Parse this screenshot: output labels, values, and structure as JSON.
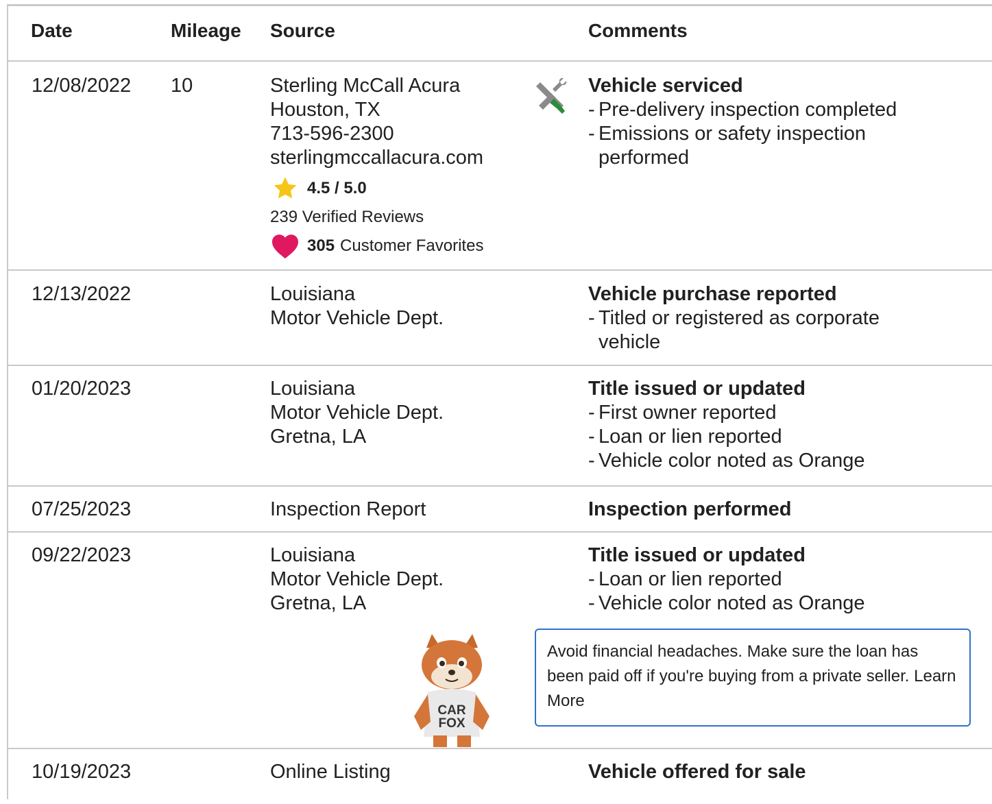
{
  "headers": {
    "date": "Date",
    "mileage": "Mileage",
    "source": "Source",
    "comments": "Comments"
  },
  "rows": [
    {
      "date": "12/08/2022",
      "mileage": "10",
      "source_lines": [
        "Sterling McCall Acura",
        "Houston, TX",
        "713-596-2300",
        "sterlingmccallacura.com"
      ],
      "rating": "4.5 / 5.0",
      "reviews": "239 Verified Reviews",
      "favorites_count": "305",
      "favorites_label": "Customer Favorites",
      "icon": "service-tools-icon",
      "comment_title": "Vehicle serviced",
      "comment_items": [
        "Pre-delivery inspection completed",
        "Emissions or safety inspection performed"
      ]
    },
    {
      "date": "12/13/2022",
      "mileage": "",
      "source_lines": [
        "Louisiana",
        "Motor Vehicle Dept."
      ],
      "comment_title": "Vehicle purchase reported",
      "comment_items": [
        "Titled or registered as corporate vehicle"
      ]
    },
    {
      "date": "01/20/2023",
      "mileage": "",
      "source_lines": [
        "Louisiana",
        "Motor Vehicle Dept.",
        "Gretna, LA"
      ],
      "comment_title": "Title issued or updated",
      "comment_items": [
        "First owner reported",
        "Loan or lien reported",
        "Vehicle color noted as Orange"
      ]
    },
    {
      "date": "07/25/2023",
      "mileage": "",
      "source_lines": [
        "Inspection Report"
      ],
      "comment_title": "Inspection performed",
      "comment_items": []
    },
    {
      "date": "09/22/2023",
      "mileage": "",
      "source_lines": [
        "Louisiana",
        "Motor Vehicle Dept.",
        "Gretna, LA"
      ],
      "comment_title": "Title issued or updated",
      "comment_items": [
        "Loan or lien reported",
        "Vehicle color noted as Orange"
      ],
      "tip_text": "Avoid financial headaches. Make sure the loan has been paid off if you're buying from a private seller.",
      "tip_link": "Learn More",
      "mascot_shirt": [
        "CAR",
        "FOX"
      ]
    },
    {
      "date": "10/19/2023",
      "mileage": "",
      "source_lines": [
        "Online Listing"
      ],
      "comment_title": "Vehicle offered for sale",
      "comment_items": []
    }
  ],
  "colors": {
    "border": "#c9c9c9",
    "star": "#f5c518",
    "heart": "#e0185f",
    "tip_border": "#2f73c8",
    "wrench_handle": "#2e8b3a"
  }
}
